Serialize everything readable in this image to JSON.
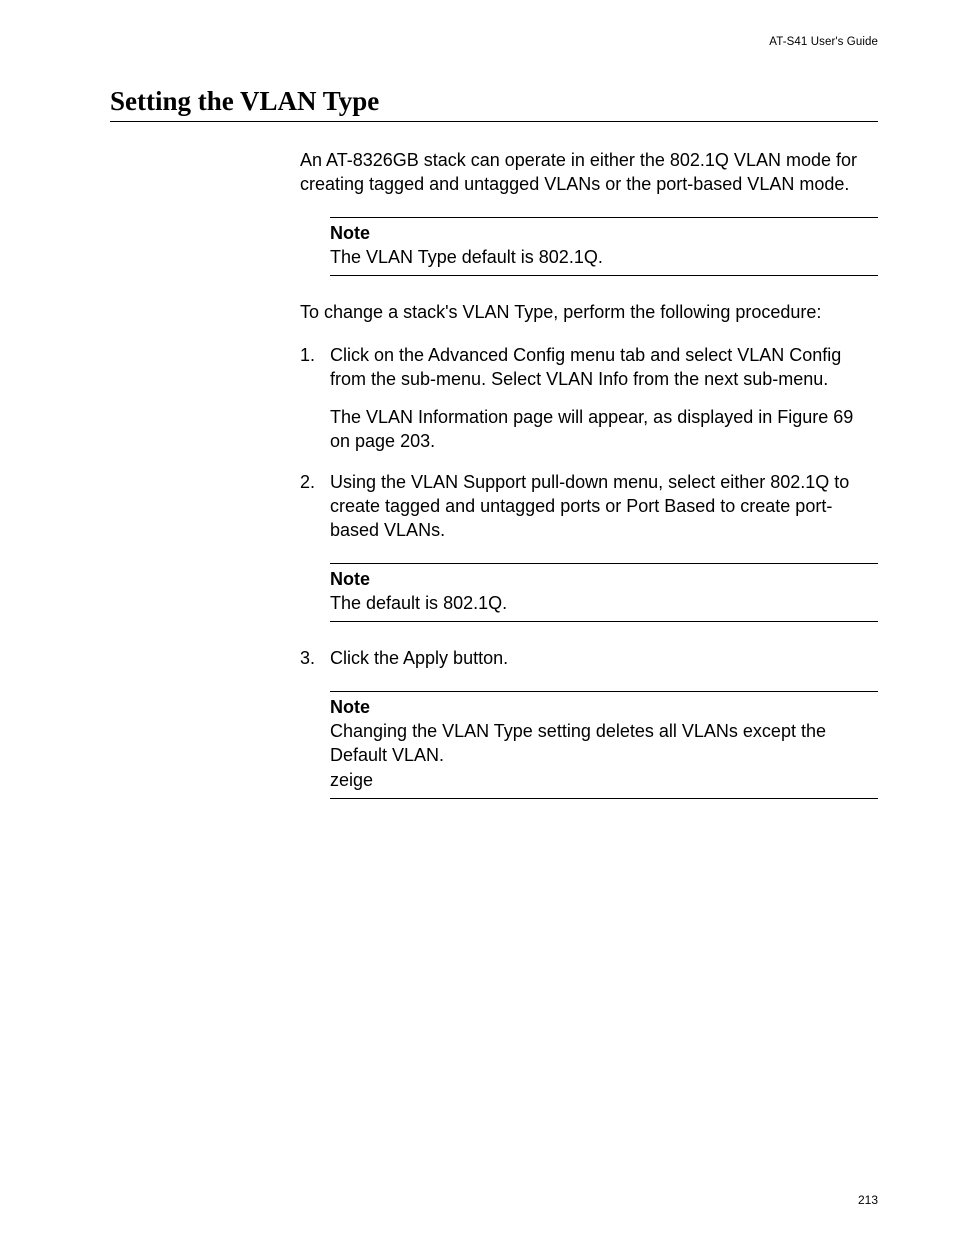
{
  "header": {
    "running_head": "AT-S41 User's Guide"
  },
  "title": "Setting the VLAN Type",
  "intro": "An AT-8326GB stack can operate in either the 802.1Q VLAN mode for creating tagged and untagged VLANs or the port-based VLAN mode.",
  "note1": {
    "label": "Note",
    "text": "The VLAN Type default is 802.1Q."
  },
  "lead": "To change a stack's VLAN Type, perform the following procedure:",
  "steps": {
    "s1": {
      "text": "Click on the Advanced Config menu tab and select VLAN Config from the sub-menu. Select VLAN Info from the next sub-menu.",
      "sub": "The VLAN Information page will appear, as displayed in Figure 69 on page 203."
    },
    "s2": {
      "text": "Using the VLAN Support pull-down menu, select either 802.1Q to create tagged and untagged ports or Port Based to create port-based VLANs."
    },
    "s3": {
      "text": "Click the Apply button."
    }
  },
  "note2": {
    "label": "Note",
    "text": "The default is 802.1Q."
  },
  "note3": {
    "label": "Note",
    "text": "Changing the VLAN Type setting deletes all VLANs except the Default VLAN."
  },
  "page_number": "213"
}
